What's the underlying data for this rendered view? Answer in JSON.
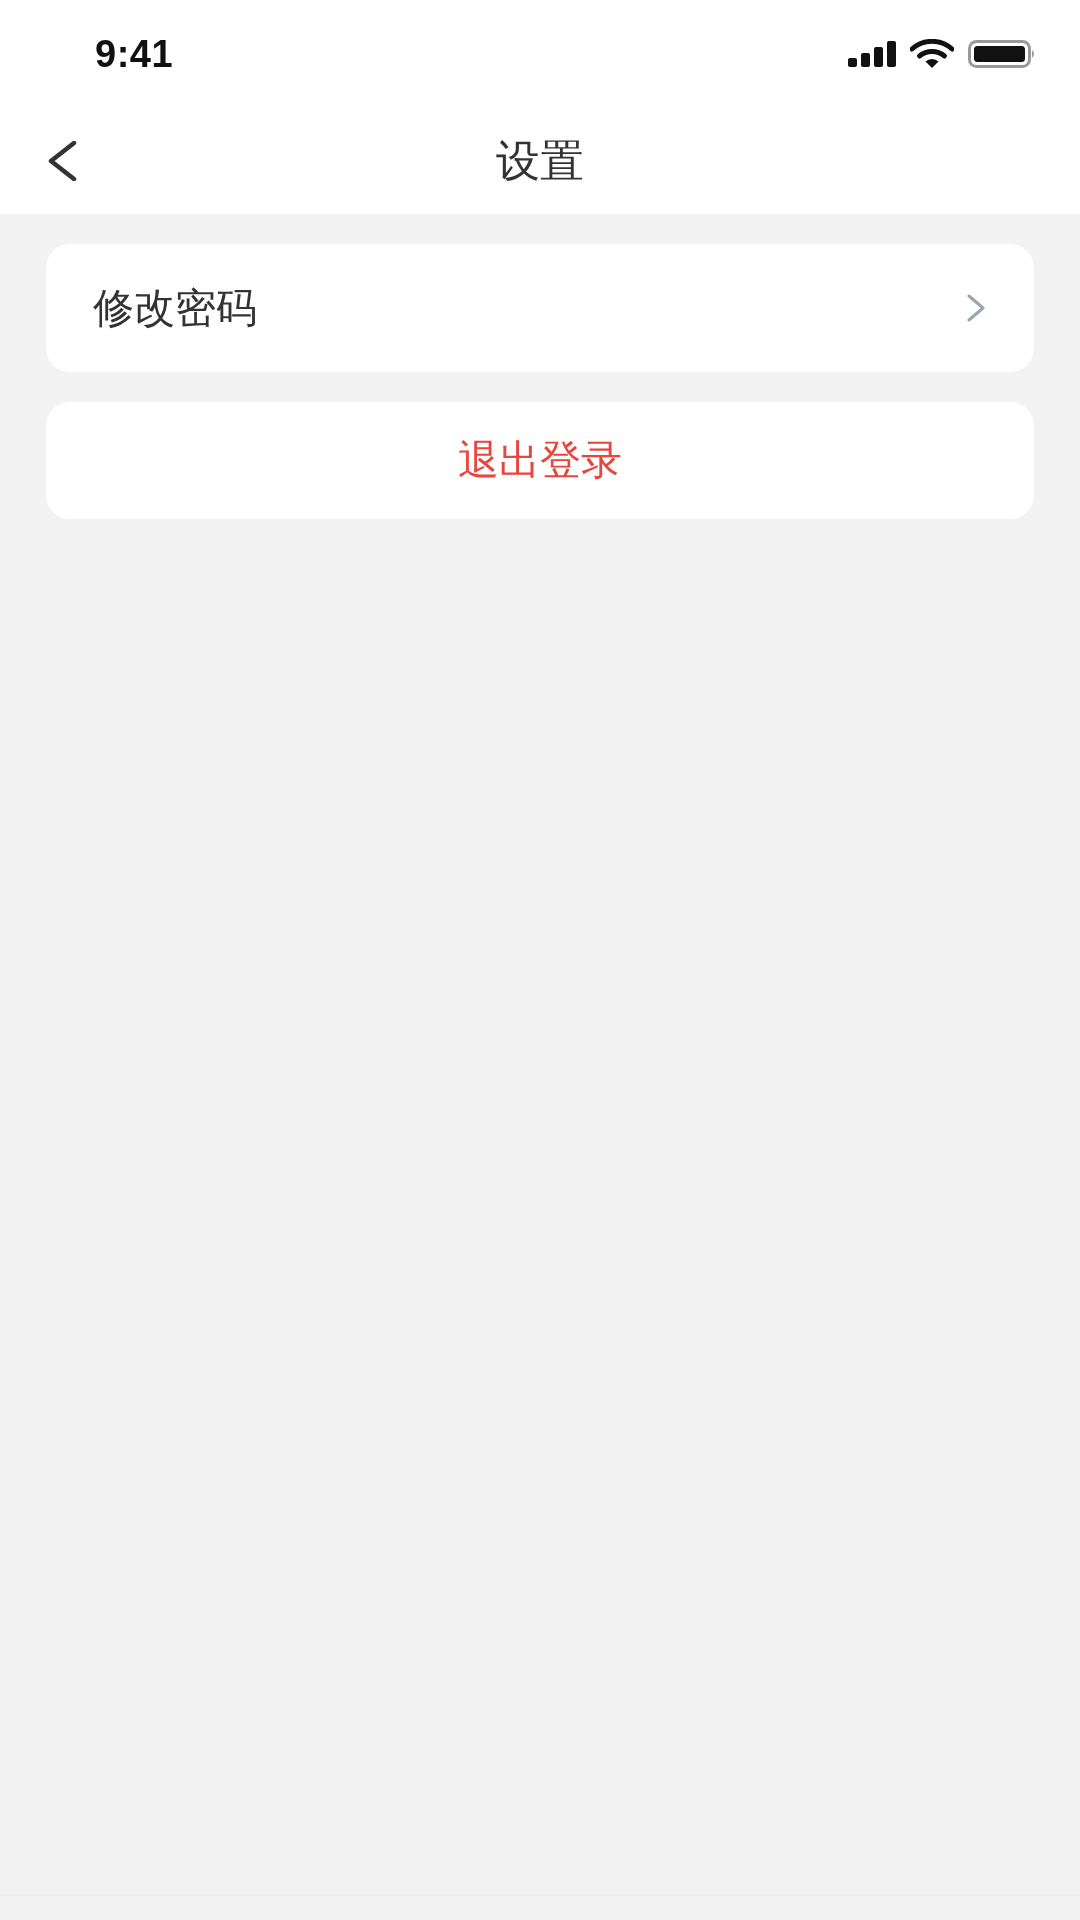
{
  "status_bar": {
    "time": "9:41"
  },
  "nav_bar": {
    "title": "设置"
  },
  "settings_items": [
    {
      "kind": "link",
      "label": "修改密码"
    },
    {
      "kind": "action",
      "label": "退出登录"
    }
  ]
}
